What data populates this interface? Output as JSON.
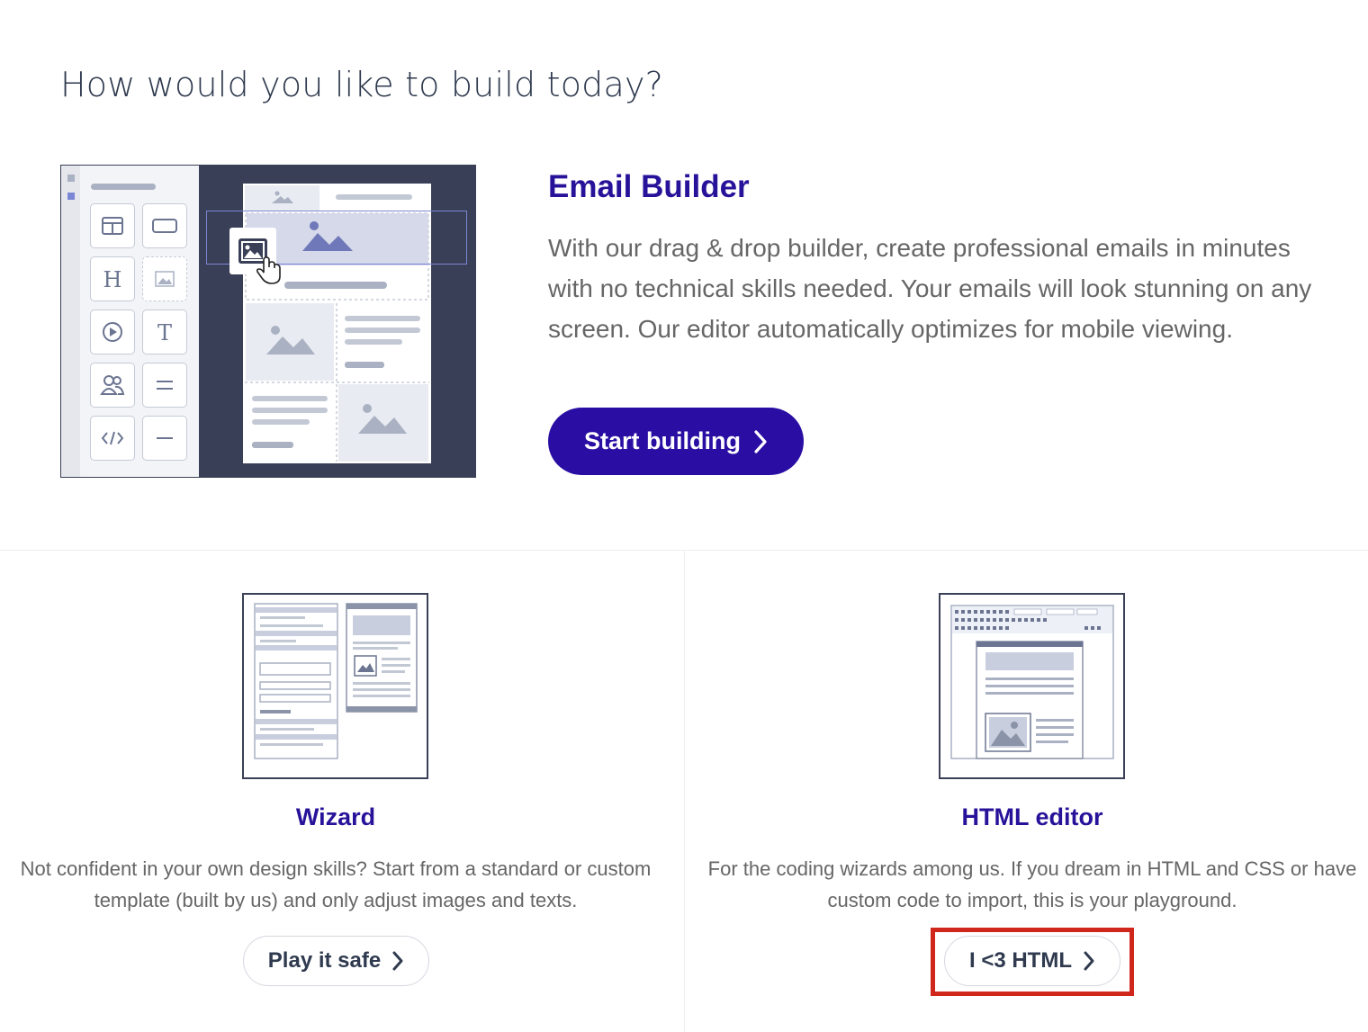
{
  "page": {
    "title": "How would you like to build today?"
  },
  "email_builder": {
    "title": "Email Builder",
    "description": "With our drag & drop builder, create professional emails in minutes with no technical skills needed. Your emails will look stunning on any screen. Our editor automatically optimizes for mobile viewing.",
    "button_label": "Start building",
    "button_color": "#2a0ea3"
  },
  "wizard": {
    "title": "Wizard",
    "description": "Not confident in your own design skills? Start from a standard or custom template (built by us) and only adjust images and texts.",
    "button_label": "Play it safe"
  },
  "html_editor": {
    "title": "HTML editor",
    "description": "For the coding wizards among us. If you dream in HTML and CSS or have custom code to import, this is your playground.",
    "button_label": "I <3 HTML",
    "highlight_color": "#d0271d"
  },
  "colors": {
    "heading": "#27129a",
    "body_text": "#666666",
    "illustration_dark": "#393f56"
  }
}
